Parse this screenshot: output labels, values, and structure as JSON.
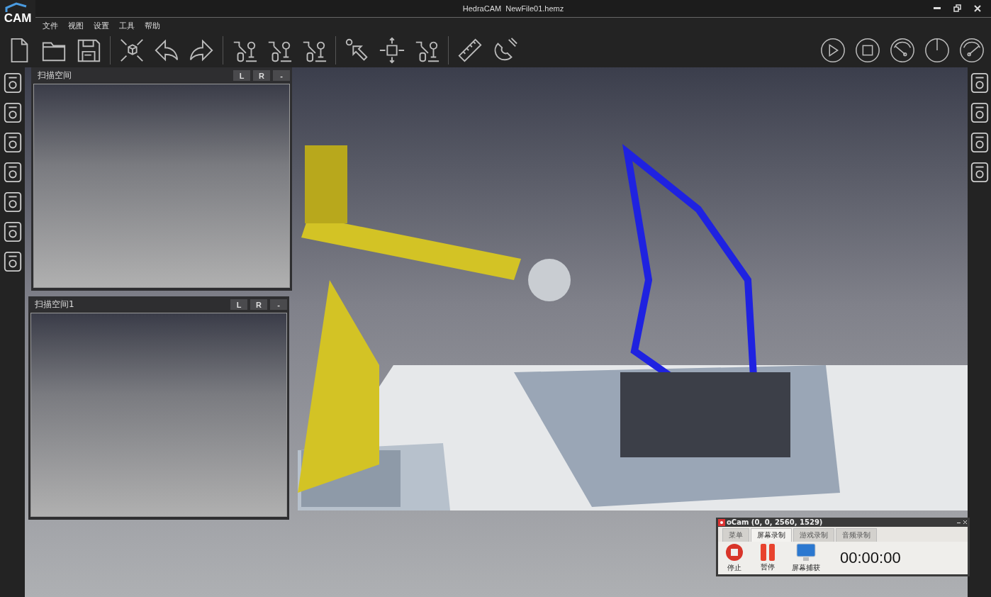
{
  "window": {
    "title": "HedraCAM  NewFile01.hemz",
    "logo": "CAM"
  },
  "menu": [
    "文件",
    "视图",
    "设置",
    "工具",
    "帮助"
  ],
  "panels": [
    {
      "title": "扫描空间",
      "buttons": [
        "L",
        "R",
        "-"
      ]
    },
    {
      "title": "扫描空间1",
      "buttons": [
        "L",
        "R",
        "-"
      ]
    }
  ],
  "recorder": {
    "title": "oCam (0, 0, 2560, 1529)",
    "tabs": [
      {
        "label": "菜单",
        "selected": false
      },
      {
        "label": "屏幕录制",
        "selected": true
      },
      {
        "label": "游戏录制",
        "selected": false
      },
      {
        "label": "音频录制",
        "selected": false
      }
    ],
    "actions": [
      {
        "kind": "stop",
        "label": "停止"
      },
      {
        "kind": "pause",
        "label": "暂停"
      },
      {
        "kind": "capture",
        "label": "屏幕捕获"
      }
    ],
    "timer": "00:00:00"
  }
}
